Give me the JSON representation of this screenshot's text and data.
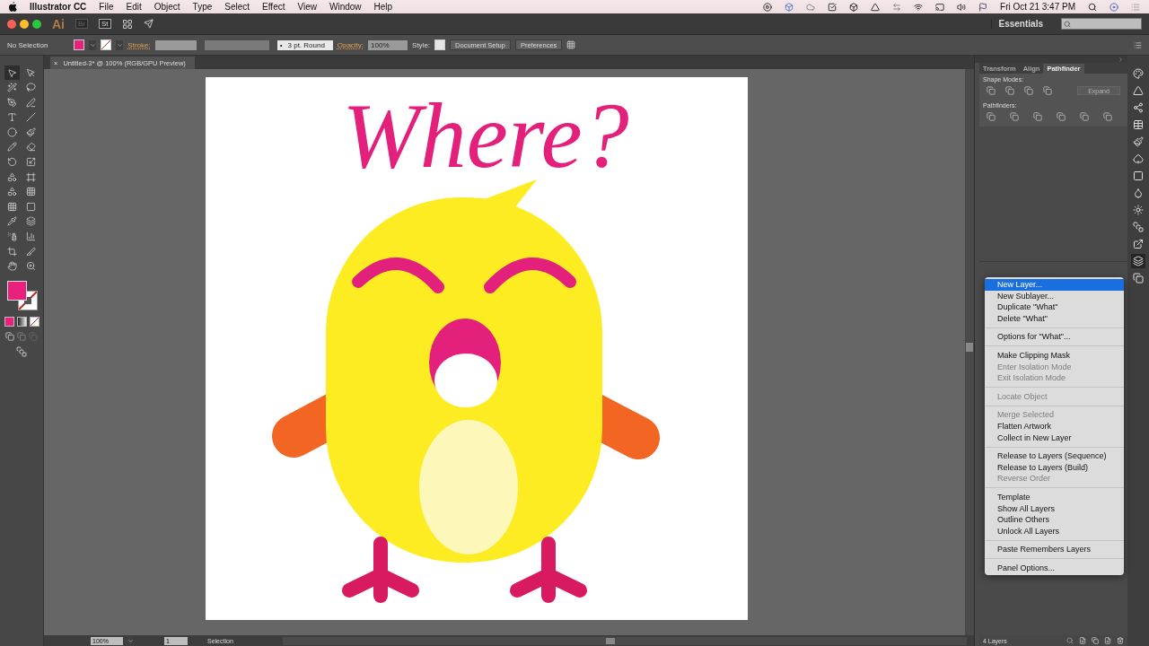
{
  "menu_bar": {
    "app_name": "Illustrator CC",
    "menus": [
      "File",
      "Edit",
      "Object",
      "Type",
      "Select",
      "Effect",
      "View",
      "Window",
      "Help"
    ],
    "clock": "Fri Oct 21  3:47 PM"
  },
  "app_bar": {
    "logo": "Ai",
    "bridge": "Br",
    "stock": "St",
    "workspace": "Essentials"
  },
  "control_bar": {
    "selection": "No Selection",
    "stroke_label": "Stroke:",
    "brush": "3 pt. Round",
    "brush_bullet": "•",
    "opacity_label": "Opacity:",
    "opacity": "100%",
    "style_label": "Style:",
    "buttons": [
      "Document Setup",
      "Preferences"
    ]
  },
  "document_tab": {
    "close": "×",
    "title": "Untitled-3* @ 100% (RGB/GPU Preview)"
  },
  "artwork": {
    "title": "Where?"
  },
  "panel": {
    "tabs": [
      {
        "label": "Transform",
        "selected": false
      },
      {
        "label": "Align",
        "selected": false
      },
      {
        "label": "Pathfinder",
        "selected": true
      }
    ],
    "shape_modes_label": "Shape Modes:",
    "expand_button": {
      "label": "Expand",
      "disabled": true
    },
    "pathfinders_label": "Pathfinders:",
    "layers_count": "4 Layers"
  },
  "context_menu": [
    [
      {
        "label": "New Layer...",
        "selected": true,
        "disabled": false
      },
      {
        "label": "New Sublayer...",
        "selected": false,
        "disabled": false
      },
      {
        "label": "Duplicate \"What\"",
        "selected": false,
        "disabled": false
      },
      {
        "label": "Delete \"What\"",
        "selected": false,
        "disabled": false
      }
    ],
    [
      {
        "label": "Options for \"What\"...",
        "selected": false,
        "disabled": false
      }
    ],
    [
      {
        "label": "Make Clipping Mask",
        "selected": false,
        "disabled": false
      },
      {
        "label": "Enter Isolation Mode",
        "selected": false,
        "disabled": true
      },
      {
        "label": "Exit Isolation Mode",
        "selected": false,
        "disabled": true
      }
    ],
    [
      {
        "label": "Locate Object",
        "selected": false,
        "disabled": true
      }
    ],
    [
      {
        "label": "Merge Selected",
        "selected": false,
        "disabled": true
      },
      {
        "label": "Flatten Artwork",
        "selected": false,
        "disabled": false
      },
      {
        "label": "Collect in New Layer",
        "selected": false,
        "disabled": false
      }
    ],
    [
      {
        "label": "Release to Layers (Sequence)",
        "selected": false,
        "disabled": false
      },
      {
        "label": "Release to Layers (Build)",
        "selected": false,
        "disabled": false
      },
      {
        "label": "Reverse Order",
        "selected": false,
        "disabled": true
      }
    ],
    [
      {
        "label": "Template",
        "selected": false,
        "disabled": false
      },
      {
        "label": "Show All Layers",
        "selected": false,
        "disabled": false
      },
      {
        "label": "Outline Others",
        "selected": false,
        "disabled": false
      },
      {
        "label": "Unlock All Layers",
        "selected": false,
        "disabled": false
      }
    ],
    [
      {
        "label": "Paste Remembers Layers",
        "selected": false,
        "disabled": false
      }
    ],
    [
      {
        "label": "Panel Options...",
        "selected": false,
        "disabled": false
      }
    ]
  ],
  "status_bar": {
    "zoom": "100%",
    "artboard": "1",
    "tool": "Selection"
  }
}
